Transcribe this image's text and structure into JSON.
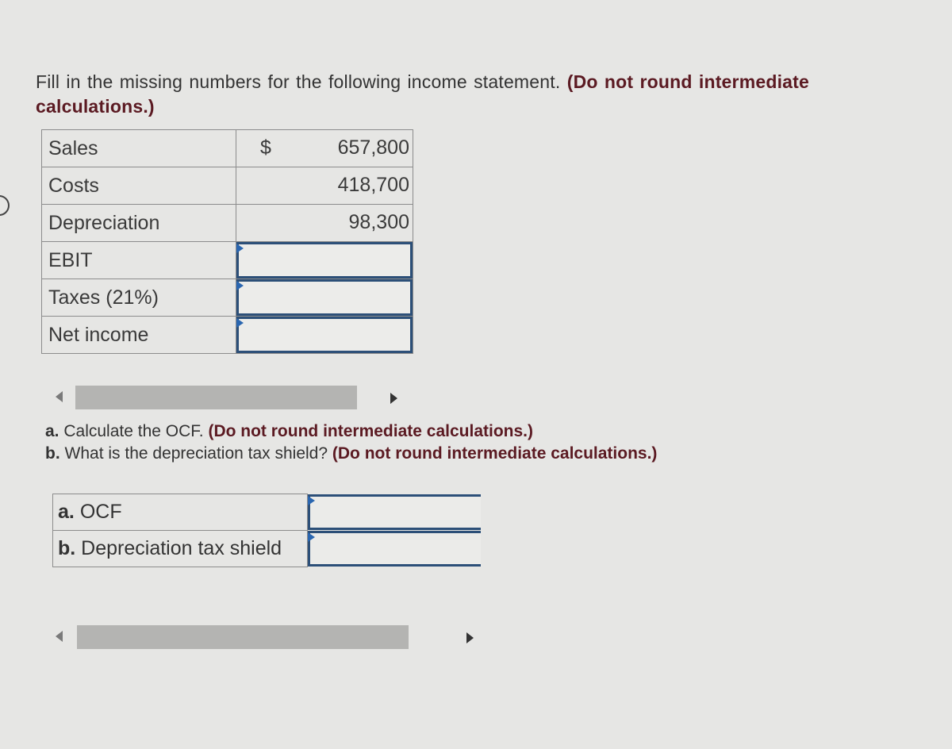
{
  "instructions": {
    "text": "Fill in the missing numbers for the following income statement.",
    "emphasis": "(Do not round intermediate calculations.)"
  },
  "income_statement": {
    "currency_symbol": "$",
    "rows": [
      {
        "label": "Sales",
        "value": "657,800"
      },
      {
        "label": "Costs",
        "value": "418,700"
      },
      {
        "label": "Depreciation",
        "value": "98,300"
      },
      {
        "label": "EBIT",
        "value": ""
      },
      {
        "label": "Taxes (21%)",
        "value": ""
      },
      {
        "label": "Net income",
        "value": ""
      }
    ]
  },
  "questions": [
    {
      "letter": "a.",
      "text": "Calculate the OCF.",
      "emphasis": "(Do not round intermediate calculations.)"
    },
    {
      "letter": "b.",
      "text": "What is the depreciation tax shield?",
      "emphasis": "(Do not round intermediate calculations.)"
    }
  ],
  "answers": [
    {
      "letter": "a.",
      "label": "OCF",
      "value": ""
    },
    {
      "letter": "b.",
      "label": "Depreciation tax shield",
      "value": ""
    }
  ],
  "colors": {
    "emphasis": "#5b1a22",
    "input_border": "#2c4f78",
    "input_flag": "#2a66b0"
  }
}
